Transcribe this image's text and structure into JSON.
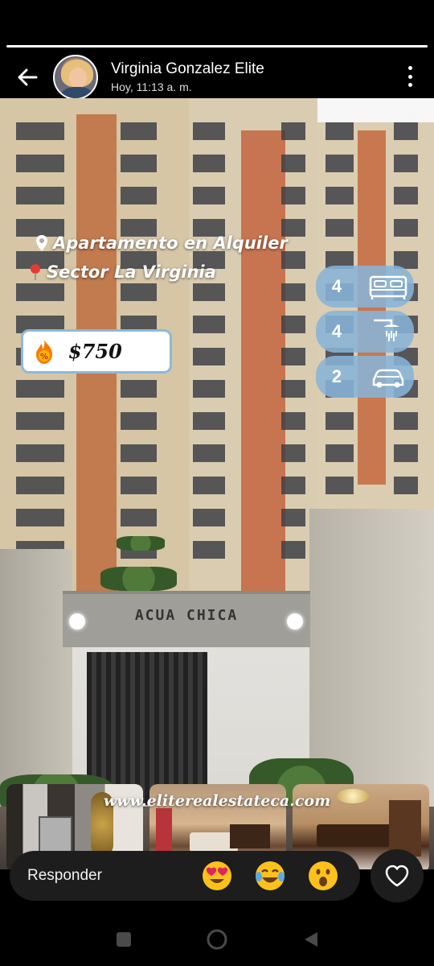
{
  "story": {
    "progress_fraction": 1.0,
    "user_name": "Virginia Gonzalez Elite",
    "timestamp": "Hoy, 11:13 a. m."
  },
  "post": {
    "location_line1": "Apartamento en Alquiler",
    "location_line2": "Sector La Virginia",
    "price": "$750",
    "building_sign": "ACUA CHICA",
    "features": [
      {
        "value": "4",
        "icon": "bed-icon"
      },
      {
        "value": "4",
        "icon": "shower-icon"
      },
      {
        "value": "2",
        "icon": "car-icon"
      }
    ],
    "thumbnails": [
      "kitchen-photo",
      "living-room-photo",
      "dining-room-photo"
    ],
    "website": "www.eliterealestateca.com"
  },
  "reply": {
    "placeholder": "Responder",
    "reactions": [
      "😍",
      "😂",
      "😮"
    ]
  },
  "colors": {
    "feature_pill": "#87b4d7",
    "price_border": "#8fb9d8",
    "reply_bg": "#1d1d1d"
  }
}
